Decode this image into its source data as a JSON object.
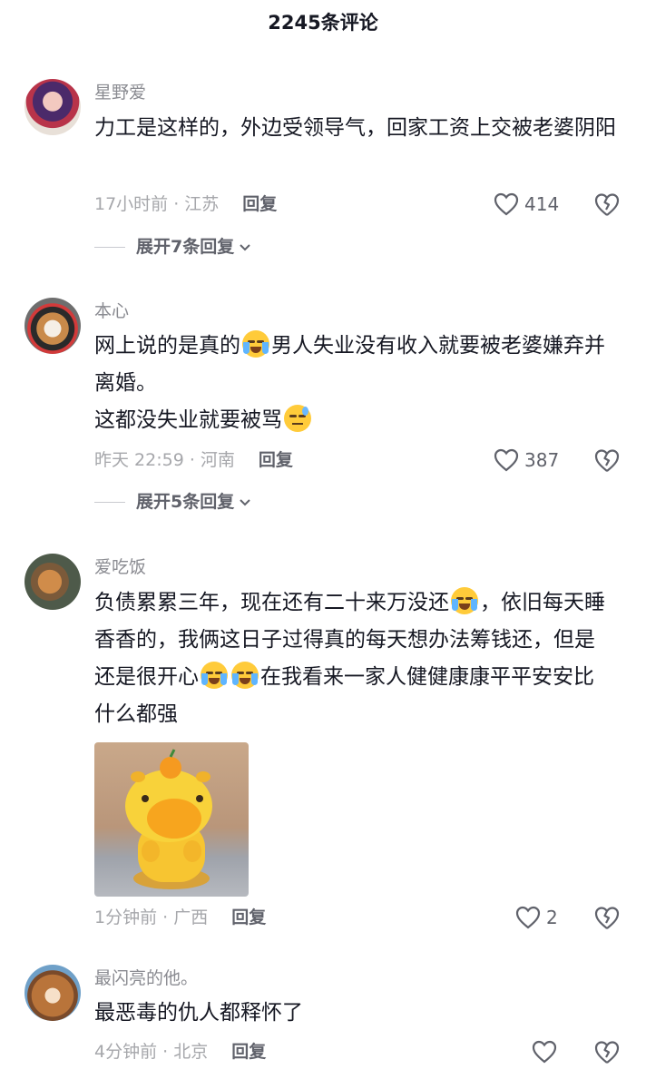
{
  "header": {
    "title": "2245条评论"
  },
  "comments": [
    {
      "username": "星野爱",
      "text": "力工是这样的，外边受领导气，回家工资上交被老婆阴阳",
      "time_location": "17小时前 · 江苏",
      "reply_label": "回复",
      "likes": "414",
      "expand_label": "展开7条回复"
    },
    {
      "username": "本心",
      "text_part1": "网上说的是真的",
      "text_part2": "男人失业没有收入就要被老婆嫌弃并离婚。",
      "text_part3": "这都没失业就要被骂",
      "time_location": "昨天 22:59 · 河南",
      "reply_label": "回复",
      "likes": "387",
      "expand_label": "展开5条回复"
    },
    {
      "username": "爱吃饭",
      "text_part1": "负债累累三年，现在还有二十来万没还",
      "text_part2": "，依旧每天睡香香的，我俩这日子过得真的每天想办法筹钱还，但是还是很开心",
      "text_part3": "在我看来一家人健健康康平平安安比什么都强",
      "time_location": "1分钟前 · 广西",
      "reply_label": "回复",
      "likes": "2"
    },
    {
      "username": "最闪亮的他。",
      "text": "最恶毒的仇人都释怀了",
      "time_location": "4分钟前 · 北京",
      "reply_label": "回复"
    }
  ],
  "colors": {
    "text": "#161823",
    "meta": "#a6a7ab",
    "emoji": "#ffcb3a"
  }
}
